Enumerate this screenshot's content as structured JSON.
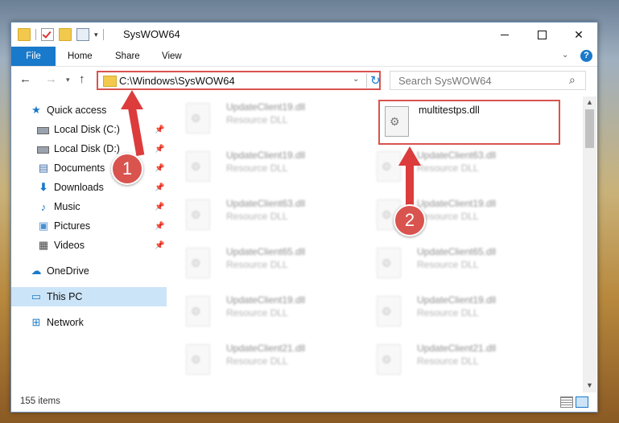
{
  "window": {
    "title": "SysWOW64",
    "controls": {
      "minimize": "",
      "maximize": "",
      "close": "✕"
    }
  },
  "ribbon": {
    "tabs": [
      "File",
      "Home",
      "Share",
      "View"
    ],
    "help": "?"
  },
  "navigation": {
    "address_path": "C:\\Windows\\SysWOW64",
    "search_placeholder": "Search SysWOW64"
  },
  "sidebar": {
    "items": [
      {
        "label": "Quick access",
        "icon": "star-icon"
      },
      {
        "label": "Local Disk (C:)",
        "icon": "drive-icon",
        "pinned": true
      },
      {
        "label": "Local Disk (D:)",
        "icon": "drive-icon",
        "pinned": true
      },
      {
        "label": "Documents",
        "icon": "documents-icon",
        "pinned": true
      },
      {
        "label": "Downloads",
        "icon": "download-icon",
        "pinned": true
      },
      {
        "label": "Music",
        "icon": "music-icon",
        "pinned": true
      },
      {
        "label": "Pictures",
        "icon": "pictures-icon",
        "pinned": true
      },
      {
        "label": "Videos",
        "icon": "videos-icon",
        "pinned": true
      },
      {
        "label": "OneDrive",
        "icon": "cloud-icon"
      },
      {
        "label": "This PC",
        "icon": "computer-icon",
        "selected": true
      },
      {
        "label": "Network",
        "icon": "network-icon"
      }
    ]
  },
  "files": {
    "highlighted": {
      "name": "multitestps.dll"
    },
    "left_column": [
      {
        "name": "UpdateClient19.dll",
        "type": "Resource DLL"
      },
      {
        "name": "UpdateClient19.dll",
        "type": "Resource DLL"
      },
      {
        "name": "UpdateClient63.dll",
        "type": "Resource DLL"
      },
      {
        "name": "UpdateClient65.dll",
        "type": "Resource DLL"
      },
      {
        "name": "UpdateClient19.dll",
        "type": "Resource DLL"
      },
      {
        "name": "UpdateClient21.dll",
        "type": "Resource DLL"
      }
    ],
    "right_column": [
      {
        "name": "UpdateClient63.dll",
        "type": "Resource DLL"
      },
      {
        "name": "UpdateClient19.dll",
        "type": "Resource DLL"
      },
      {
        "name": "UpdateClient65.dll",
        "type": "Resource DLL"
      },
      {
        "name": "UpdateClient19.dll",
        "type": "Resource DLL"
      },
      {
        "name": "UpdateClient21.dll",
        "type": "Resource DLL"
      }
    ]
  },
  "status": {
    "item_count": "155 items"
  },
  "annotations": {
    "step1": "1",
    "step2": "2",
    "color": "#d9534f"
  }
}
